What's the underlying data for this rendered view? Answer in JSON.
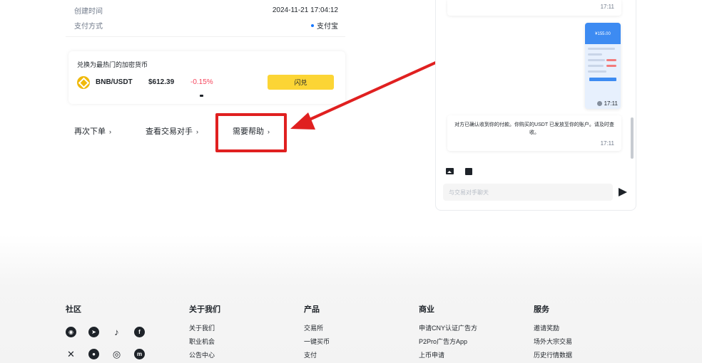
{
  "order": {
    "created_label": "创建时间",
    "created_value": "2024-11-21 17:04:12",
    "payment_label": "支付方式",
    "payment_value": "支付宝"
  },
  "promo": {
    "title": "兑换为最热门的加密货币",
    "pair": "BNB/USDT",
    "price": "$612.39",
    "change": "-0.15%",
    "button": "闪兑"
  },
  "actions": {
    "reorder": "再次下单",
    "view_counterparty": "查看交易对手",
    "need_help": "需要帮助"
  },
  "chat": {
    "first_msg_time": "17:11",
    "screenshot_amount": "¥155.00",
    "screenshot_time": "17:11",
    "system_msg": "对方已确认收到你的付款。你购买的USDT 已发放至你的账户。请及时查收。",
    "system_time": "17:11",
    "input_placeholder": "与交易对手聊天"
  },
  "footer": {
    "community": {
      "title": "社区",
      "icons": [
        "discord-icon",
        "telegram-icon",
        "tiktok-icon",
        "facebook-icon",
        "x-icon",
        "reddit-icon",
        "instagram-icon",
        "coinmarketcap-icon"
      ]
    },
    "about": {
      "title": "关于我们",
      "links": [
        "关于我们",
        "职业机会",
        "公告中心"
      ]
    },
    "products": {
      "title": "产品",
      "links": [
        "交易所",
        "一键买币",
        "支付"
      ]
    },
    "business": {
      "title": "商业",
      "links": [
        "申请CNY认证广告方",
        "P2Pro广告方App",
        "上币申请"
      ]
    },
    "service": {
      "title": "服务",
      "links": [
        "邀请奖励",
        "场外大宗交易",
        "历史行情数据"
      ]
    }
  },
  "colors": {
    "accent": "#fcd535",
    "negative": "#f6465d",
    "highlight": "#e02020"
  }
}
